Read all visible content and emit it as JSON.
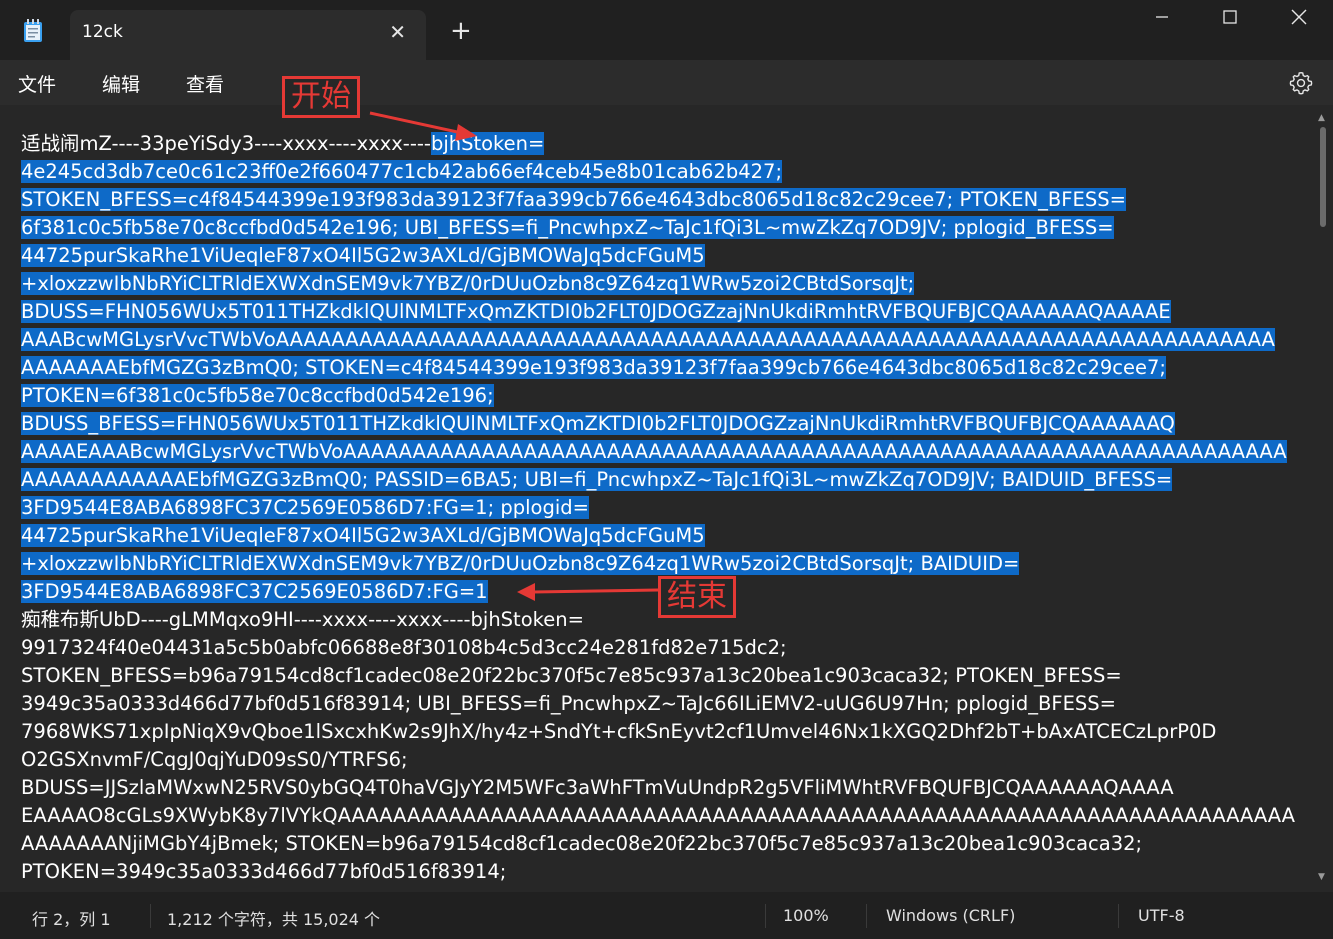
{
  "tab": {
    "title": "12ck"
  },
  "menu": {
    "file": "文件",
    "edit": "编辑",
    "view": "查看"
  },
  "annotations": {
    "start": "开始",
    "end": "结束"
  },
  "editor": {
    "lines": [
      [
        {
          "t": "适战闹mZ----33peYiSdy3----xxxx----xxxx----",
          "s": false
        },
        {
          "t": "bjhStoken=",
          "s": true
        }
      ],
      [
        {
          "t": "4e245cd3db7ce0c61c23ff0e2f660477c1cb42ab66ef4ceb45e8b01cab62b427;",
          "s": true
        }
      ],
      [
        {
          "t": "STOKEN_BFESS=c4f84544399e193f983da39123f7faa399cb766e4643dbc8065d18c82c29cee7; PTOKEN_BFESS=",
          "s": true
        }
      ],
      [
        {
          "t": "6f381c0c5fb58e70c8ccfbd0d542e196; UBI_BFESS=fi_PncwhpxZ~TaJc1fQi3L~mwZkZq7OD9JV; pplogid_BFESS=",
          "s": true
        }
      ],
      [
        {
          "t": "44725purSkaRhe1ViUeqleF87xO4Il5G2w3AXLd/GjBMOWaJq5dcFGuM5",
          "s": true
        }
      ],
      [
        {
          "t": "+xloxzzwIbNbRYiCLTRldEXWXdnSEM9vk7YBZ/0rDUuOzbn8c9Z64zq1WRw5zoi2CBtdSorsqJt;",
          "s": true
        }
      ],
      [
        {
          "t": "BDUSS=FHN056WUx5T011THZkdklQUlNMLTFxQmZKTDI0b2FLT0JDOGZzajNnUkdiRmhtRVFBQUFBJCQAAAAAAQAAAAE",
          "s": true
        }
      ],
      [
        {
          "t": "AAABcwMGLysrVvcTWbVoAAAAAAAAAAAAAAAAAAAAAAAAAAAAAAAAAAAAAAAAAAAAAAAAAAAAAAAAAAAAAAAAAAAAAAAA",
          "s": true
        }
      ],
      [
        {
          "t": "AAAAAAAEbfMGZG3zBmQ0; STOKEN=c4f84544399e193f983da39123f7faa399cb766e4643dbc8065d18c82c29cee7;",
          "s": true
        }
      ],
      [
        {
          "t": "PTOKEN=6f381c0c5fb58e70c8ccfbd0d542e196;",
          "s": true
        }
      ],
      [
        {
          "t": "BDUSS_BFESS=FHN056WUx5T011THZkdklQUlNMLTFxQmZKTDI0b2FLT0JDOGZzajNnUkdiRmhtRVFBQUFBJCQAAAAAAQ",
          "s": true
        }
      ],
      [
        {
          "t": "AAAAEAAABcwMGLysrVvcTWbVoAAAAAAAAAAAAAAAAAAAAAAAAAAAAAAAAAAAAAAAAAAAAAAAAAAAAAAAAAAAAAAAAAAAA",
          "s": true
        }
      ],
      [
        {
          "t": "AAAAAAAAAAAAEbfMGZG3zBmQ0; PASSID=6BA5; UBI=fi_PncwhpxZ~TaJc1fQi3L~mwZkZq7OD9JV; BAIDUID_BFESS=",
          "s": true
        }
      ],
      [
        {
          "t": "3FD9544E8ABA6898FC37C2569E0586D7:FG=1; pplogid=",
          "s": true
        }
      ],
      [
        {
          "t": "44725purSkaRhe1ViUeqleF87xO4Il5G2w3AXLd/GjBMOWaJq5dcFGuM5",
          "s": true
        }
      ],
      [
        {
          "t": "+xloxzzwIbNbRYiCLTRldEXWXdnSEM9vk7YBZ/0rDUuOzbn8c9Z64zq1WRw5zoi2CBtdSorsqJt; BAIDUID=",
          "s": true
        }
      ],
      [
        {
          "t": "3FD9544E8ABA6898FC37C2569E0586D7:FG=1",
          "s": true
        }
      ],
      [
        {
          "t": "痴稚布斯UbD----gLMMqxo9HI----xxxx----xxxx----bjhStoken=",
          "s": false
        }
      ],
      [
        {
          "t": "9917324f40e04431a5c5b0abfc06688e8f30108b4c5d3cc24e281fd82e715dc2;",
          "s": false
        }
      ],
      [
        {
          "t": "STOKEN_BFESS=b96a79154cd8cf1cadec08e20f22bc370f5c7e85c937a13c20bea1c903caca32; PTOKEN_BFESS=",
          "s": false
        }
      ],
      [
        {
          "t": "3949c35a0333d466d77bf0d516f83914; UBI_BFESS=fi_PncwhpxZ~TaJc66ILiEMV2-uUG6U97Hn; pplogid_BFESS=",
          "s": false
        }
      ],
      [
        {
          "t": "7968WKS71xpIpNiqX9vQboe1lSxcxhKw2s9JhX/hy4z+SndYt+cfkSnEyvt2cf1Umvel46Nx1kXGQ2Dhf2bT+bAxATCECzLprP0D",
          "s": false
        }
      ],
      [
        {
          "t": "O2GSXnvmF/CqgJ0qjYuD09sS0/YTRFS6;",
          "s": false
        }
      ],
      [
        {
          "t": "BDUSS=JJSzlaMWxwN25RVS0ybGQ4T0haVGJyY2M5WFc3aWhFTmVuUndpR2g5VFliMWhtRVFBQUFBJCQAAAAAAQAAAA",
          "s": false
        }
      ],
      [
        {
          "t": "EAAAAO8cGLs9XWybK8y7lVYkQAAAAAAAAAAAAAAAAAAAAAAAAAAAAAAAAAAAAAAAAAAAAAAAAAAAAAAAAAAAAAAAAAAAAA",
          "s": false
        }
      ],
      [
        {
          "t": "AAAAAAANjiMGbY4jBmek; STOKEN=b96a79154cd8cf1cadec08e20f22bc370f5c7e85c937a13c20bea1c903caca32;",
          "s": false
        }
      ],
      [
        {
          "t": "PTOKEN=3949c35a0333d466d77bf0d516f83914;",
          "s": false
        }
      ]
    ]
  },
  "status": {
    "position": "行 2，列 1",
    "chars": "1,212 个字符，共 15,024 个",
    "zoom": "100%",
    "line_ending": "Windows (CRLF)",
    "encoding": "UTF-8"
  },
  "colors": {
    "selection": "#0e6ac8",
    "annotation": "#e53935",
    "background": "#272727"
  }
}
